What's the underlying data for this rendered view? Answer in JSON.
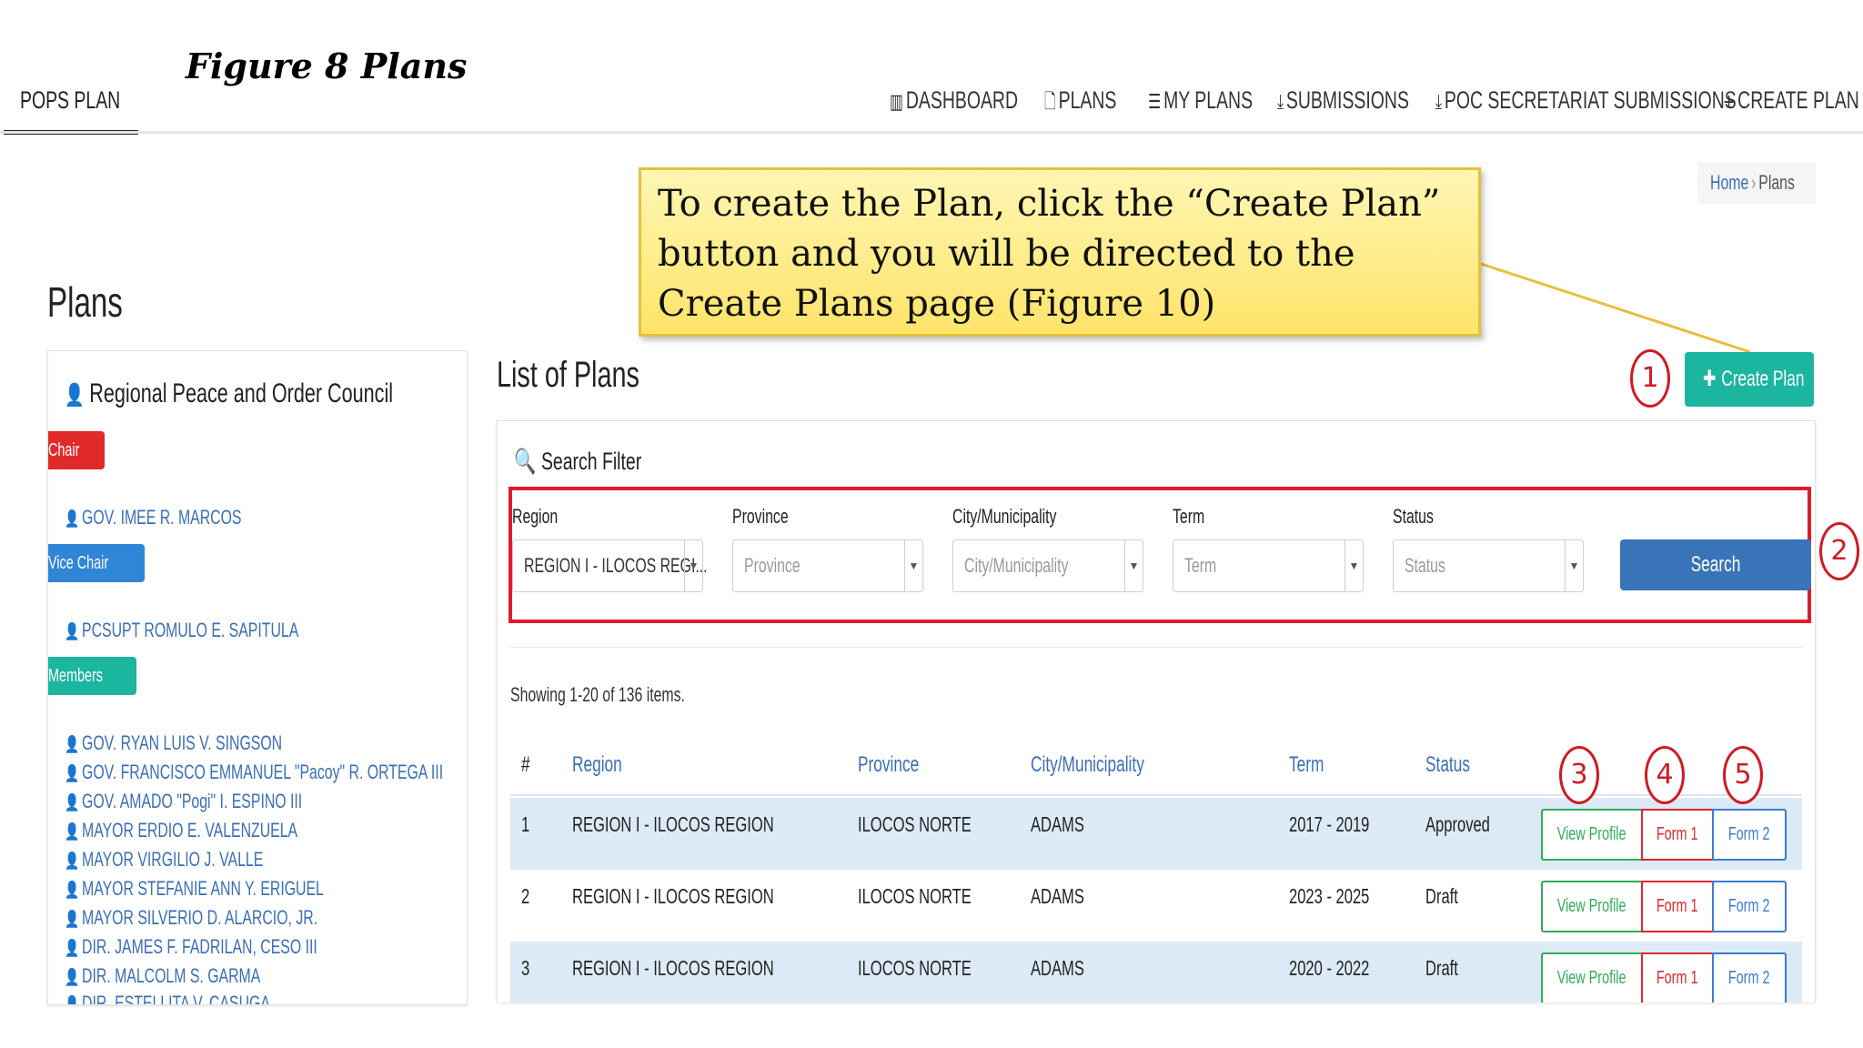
{
  "figure_caption": "Figure 8 Plans",
  "brand": "POPS PLAN",
  "nav": [
    {
      "icon": "bar-chart-icon",
      "glyph": "▥",
      "label": "DASHBOARD"
    },
    {
      "icon": "file-icon",
      "glyph": "🗋",
      "label": "PLANS"
    },
    {
      "icon": "list-icon",
      "glyph": "☰",
      "label": "MY PLANS"
    },
    {
      "icon": "download-icon",
      "glyph": "⤓",
      "label": "SUBMISSIONS"
    },
    {
      "icon": "download-icon",
      "glyph": "⤓",
      "label": "POC SECRETARIAT SUBMISSIONS"
    },
    {
      "icon": "plus-icon",
      "glyph": "+",
      "label": "CREATE PLAN"
    }
  ],
  "callout": "To create the Plan, click the “Create Plan” button and you will be directed to the Create Plans page (Figure 10)",
  "breadcrumb": {
    "home": "Home",
    "sep": "›",
    "current": "Plans"
  },
  "page_title": "Plans",
  "council": {
    "title": "Regional Peace and Order Council",
    "chair_label": "Chair",
    "chair": "GOV. IMEE R. MARCOS",
    "vice_label": "Vice Chair",
    "vice": "PCSUPT ROMULO E. SAPITULA",
    "members_label": "Members",
    "members": [
      "GOV. RYAN LUIS V. SINGSON",
      "GOV. FRANCISCO EMMANUEL \"Pacoy\" R. ORTEGA III",
      "GOV. AMADO \"Pogi\" I. ESPINO III",
      "MAYOR ERDIO E. VALENZUELA",
      "MAYOR VIRGILIO J. VALLE",
      "MAYOR STEFANIE ANN Y. ERIGUEL",
      "MAYOR SILVERIO D. ALARCIO, JR.",
      "DIR. JAMES F. FADRILAN, CESO III",
      "DIR. MALCOLM S. GARMA",
      "DIR. ESTELLITA V. CASUGA"
    ],
    "colors": {
      "chair": "#e02a2a",
      "vice": "#2f86d6",
      "members": "#1bb5a0"
    }
  },
  "list_title": "List of Plans",
  "create_plan_button": "Create Plan",
  "search_filter": {
    "title": "Search Filter",
    "fields": [
      {
        "label": "Region",
        "value": "REGION I - ILOCOS REGI..."
      },
      {
        "label": "Province",
        "placeholder": "Province"
      },
      {
        "label": "City/Municipality",
        "placeholder": "City/Municipality"
      },
      {
        "label": "Term",
        "placeholder": "Term"
      },
      {
        "label": "Status",
        "placeholder": "Status"
      }
    ],
    "search_button": "Search"
  },
  "showing_text": "Showing 1-20 of 136 items.",
  "table": {
    "headers": [
      "#",
      "Region",
      "Province",
      "City/Municipality",
      "Term",
      "Status"
    ],
    "rows": [
      {
        "num": "1",
        "region": "REGION I - ILOCOS REGION",
        "province": "ILOCOS NORTE",
        "city": "ADAMS",
        "term": "2017 - 2019",
        "status": "Approved"
      },
      {
        "num": "2",
        "region": "REGION I - ILOCOS REGION",
        "province": "ILOCOS NORTE",
        "city": "ADAMS",
        "term": "2023 - 2025",
        "status": "Draft"
      },
      {
        "num": "3",
        "region": "REGION I - ILOCOS REGION",
        "province": "ILOCOS NORTE",
        "city": "ADAMS",
        "term": "2020 - 2022",
        "status": "Draft"
      }
    ],
    "actions": {
      "view_profile": "View Profile",
      "form1": "Form 1",
      "form2": "Form 2"
    }
  },
  "markers": [
    "1",
    "2",
    "3",
    "4",
    "5"
  ]
}
